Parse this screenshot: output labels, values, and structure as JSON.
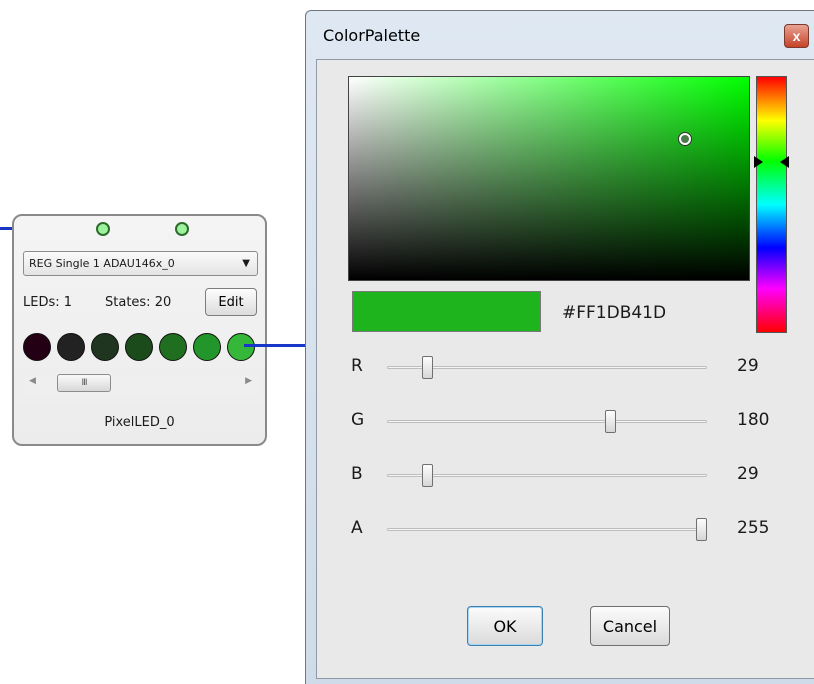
{
  "block": {
    "module_select": "REG Single 1 ADAU146x_0",
    "leds_label": "LEDs: 1",
    "states_label": "States: 20",
    "edit_label": "Edit",
    "scroll_grip": "III",
    "name": "PixelLED_0",
    "led_colors": [
      "#240014",
      "#222222",
      "#203520",
      "#1b4a1b",
      "#206f20",
      "#22962a",
      "#35b83a"
    ]
  },
  "dialog": {
    "title": "ColorPalette",
    "close_glyph": "x",
    "hex": "#FF1DB41D",
    "swatch_color": "#1DB41D",
    "channels": [
      {
        "label": "R",
        "value": "29",
        "fraction": 0.114
      },
      {
        "label": "G",
        "value": "180",
        "fraction": 0.706
      },
      {
        "label": "B",
        "value": "29",
        "fraction": 0.114
      },
      {
        "label": "A",
        "value": "255",
        "fraction": 1.0
      }
    ],
    "ok_label": "OK",
    "cancel_label": "Cancel"
  },
  "colors": {
    "wire": "#1836c8",
    "pin_fill": "#9df29d",
    "hue_selected": "#00ff00"
  }
}
